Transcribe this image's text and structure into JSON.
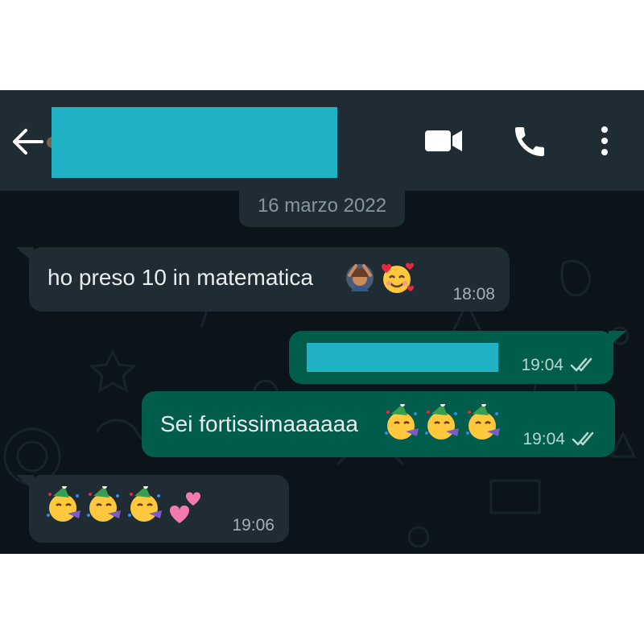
{
  "header": {
    "back_icon": "arrow-left-icon",
    "contact_name_redacted": true,
    "actions": [
      {
        "icon": "video-camera-icon"
      },
      {
        "icon": "phone-icon"
      },
      {
        "icon": "more-vertical-icon"
      }
    ]
  },
  "chat": {
    "date_label": "16 marzo 2022",
    "messages": [
      {
        "direction": "incoming",
        "text": "ho preso 10 in matematica",
        "emojis": [
          "woman-gesturing-ok",
          "smiling-face-with-hearts"
        ],
        "time": "18:08"
      },
      {
        "direction": "outgoing",
        "text_redacted": true,
        "time": "19:04",
        "status": "read-double-check"
      },
      {
        "direction": "outgoing",
        "text": "Sei fortissimaaaaaa",
        "emojis": [
          "partying-face",
          "partying-face",
          "partying-face"
        ],
        "time": "19:04",
        "status": "read-double-check"
      },
      {
        "direction": "incoming",
        "emojis": [
          "partying-face",
          "partying-face",
          "partying-face",
          "two-hearts"
        ],
        "time": "19:06"
      }
    ]
  },
  "colors": {
    "header_bg": "#1f2c34",
    "chat_bg": "#0b141a",
    "incoming_bubble": "#1f2c34",
    "outgoing_bubble": "#005c4b",
    "redaction": "#1eb2c4",
    "text": "#e9edef",
    "meta_text": "#8696a0"
  }
}
